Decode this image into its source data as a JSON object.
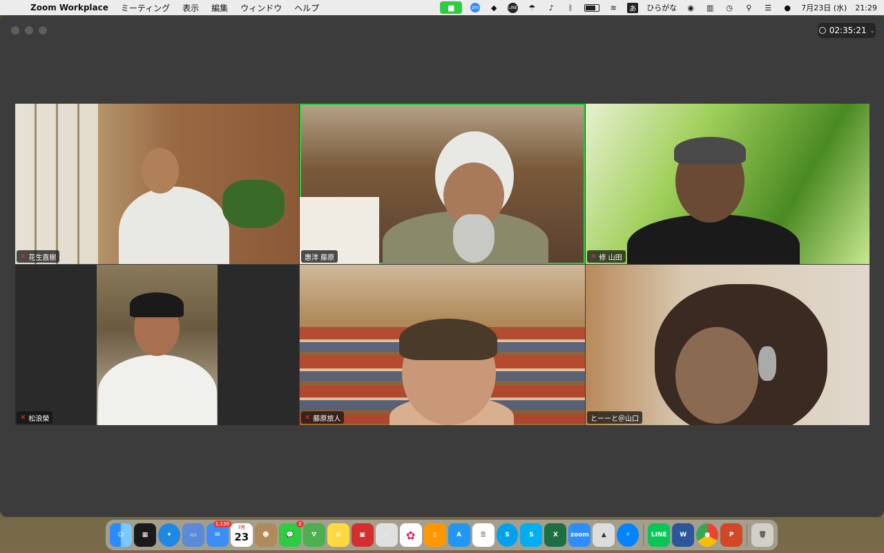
{
  "menubar": {
    "app_name": "Zoom Workplace",
    "menus": [
      "ミーティング",
      "表示",
      "編集",
      "ウィンドウ",
      "ヘルプ"
    ],
    "ime_label": "あ",
    "ime_mode": "ひらがな",
    "date": "7月23日 (水)",
    "time": "21:29",
    "line_label": "LINE",
    "zm_label": "zm"
  },
  "window": {
    "timer": "02:35:21"
  },
  "participants": [
    {
      "name": "花生直樹",
      "muted": true,
      "active": false
    },
    {
      "name": "惠洋 藤原",
      "muted": false,
      "active": true
    },
    {
      "name": "修 山田",
      "muted": true,
      "active": false
    },
    {
      "name": "松浪榮",
      "muted": true,
      "active": false
    },
    {
      "name": "藤原旅人",
      "muted": true,
      "active": false
    },
    {
      "name": "とーーと＠山口",
      "muted": false,
      "active": false
    }
  ],
  "dock": {
    "mail_badge": "1,130",
    "messages_badge": "2",
    "calendar_month": "7月",
    "calendar_day": "23",
    "zoom_label": "zoom",
    "line_label": "LINE",
    "word_label": "W",
    "excel_label": "X",
    "ppt_label": "P"
  },
  "colors": {
    "active_speaker": "#2ecc40",
    "mic_muted": "#e53935"
  }
}
